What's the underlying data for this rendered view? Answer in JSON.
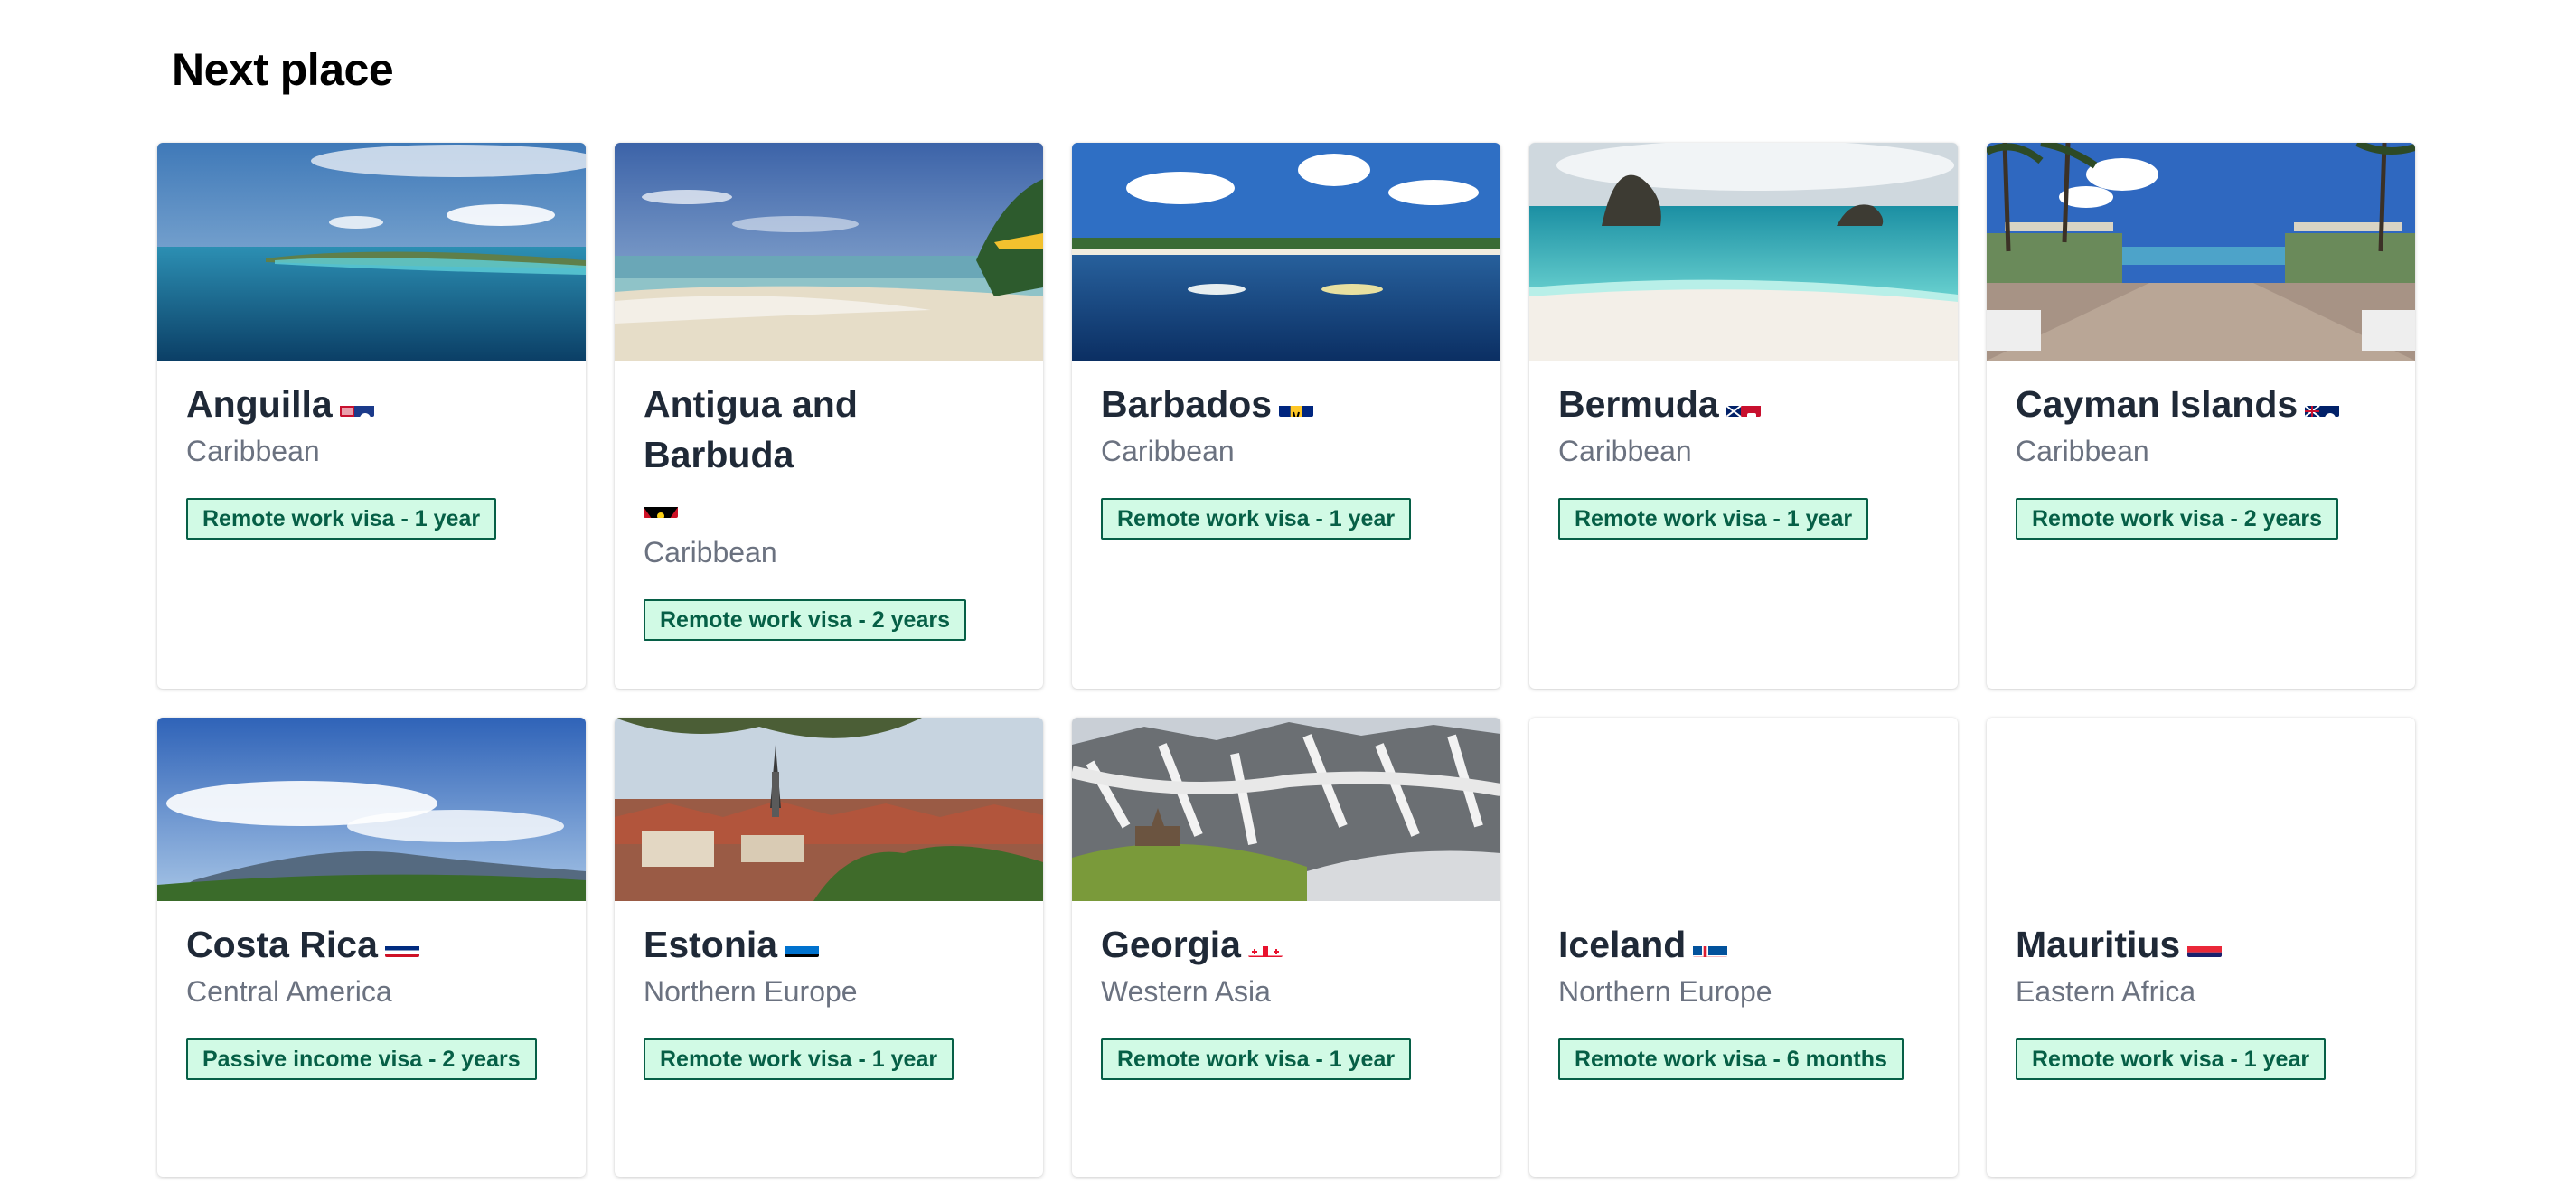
{
  "page": {
    "title": "Next place"
  },
  "cards": [
    {
      "name": "Anguilla",
      "region": "Caribbean",
      "visa": "Remote work visa - 1 year",
      "flag_icon": "anguilla-flag"
    },
    {
      "name": "Antigua and Barbuda",
      "region": "Caribbean",
      "visa": "Remote work visa - 2 years",
      "flag_icon": "antigua-and-barbuda-flag"
    },
    {
      "name": "Barbados",
      "region": "Caribbean",
      "visa": "Remote work visa - 1 year",
      "flag_icon": "barbados-flag"
    },
    {
      "name": "Bermuda",
      "region": "Caribbean",
      "visa": "Remote work visa - 1 year",
      "flag_icon": "bermuda-flag"
    },
    {
      "name": "Cayman Islands",
      "region": "Caribbean",
      "visa": "Remote work visa - 2 years",
      "flag_icon": "cayman-islands-flag"
    },
    {
      "name": "Costa Rica",
      "region": "Central America",
      "visa": "Passive income visa - 2 years",
      "flag_icon": "costa-rica-flag"
    },
    {
      "name": "Estonia",
      "region": "Northern Europe",
      "visa": "Remote work visa - 1 year",
      "flag_icon": "estonia-flag"
    },
    {
      "name": "Georgia",
      "region": "Western Asia",
      "visa": "Remote work visa - 1 year",
      "flag_icon": "georgia-flag"
    },
    {
      "name": "Iceland",
      "region": "Northern Europe",
      "visa": "Remote work visa - 6 months",
      "flag_icon": "iceland-flag"
    },
    {
      "name": "Mauritius",
      "region": "Eastern Africa",
      "visa": "Remote work visa - 1 year",
      "flag_icon": "mauritius-flag"
    }
  ],
  "colors": {
    "badge_bg": "#d1fae5",
    "badge_text": "#065f46",
    "title_text": "#1f2937",
    "region_text": "#6b7280"
  }
}
